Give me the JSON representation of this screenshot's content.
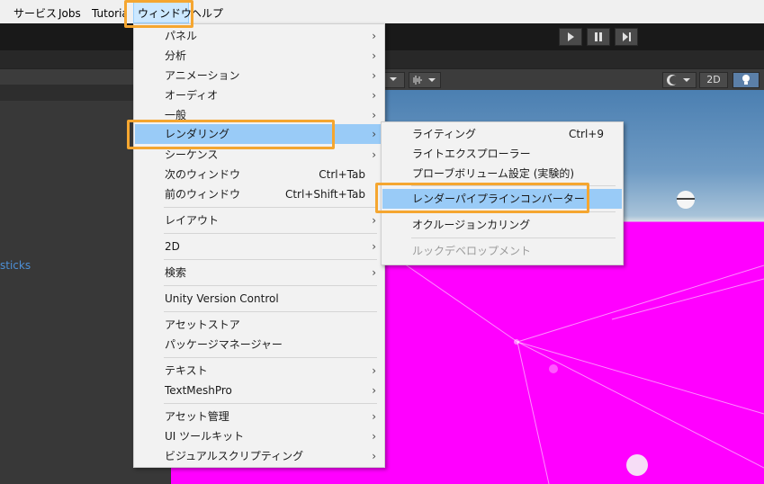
{
  "menubar": {
    "items": [
      "サービス",
      "Jobs",
      "Tutorials",
      "ウィンドウ",
      "ヘルプ"
    ]
  },
  "toolbar": {
    "play_icon": "play-icon",
    "pause_icon": "pause-icon",
    "step_icon": "step-icon"
  },
  "scene": {
    "mode_2d_label": "2D"
  },
  "hierarchy": {
    "partial_text": "sticks"
  },
  "window_menu": {
    "items": [
      {
        "label": "パネル",
        "shortcut": "",
        "submenu": true
      },
      {
        "label": "分析",
        "shortcut": "",
        "submenu": true
      },
      {
        "label": "アニメーション",
        "shortcut": "",
        "submenu": true
      },
      {
        "label": "オーディオ",
        "shortcut": "",
        "submenu": true
      },
      {
        "label": "一般",
        "shortcut": "",
        "submenu": true
      },
      {
        "label": "レンダリング",
        "shortcut": "",
        "submenu": true,
        "highlighted": true
      },
      {
        "label": "シーケンス",
        "shortcut": "",
        "submenu": true
      },
      {
        "label": "次のウィンドウ",
        "shortcut": "Ctrl+Tab",
        "submenu": false
      },
      {
        "label": "前のウィンドウ",
        "shortcut": "Ctrl+Shift+Tab",
        "submenu": false
      },
      {
        "label": "レイアウト",
        "shortcut": "",
        "submenu": true
      },
      {
        "label": "2D",
        "shortcut": "",
        "submenu": true
      },
      {
        "label": "検索",
        "shortcut": "",
        "submenu": true
      },
      {
        "label": "Unity Version Control",
        "shortcut": "",
        "submenu": false
      },
      {
        "label": "アセットストア",
        "shortcut": "",
        "submenu": false
      },
      {
        "label": "パッケージマネージャー",
        "shortcut": "",
        "submenu": false
      },
      {
        "label": "テキスト",
        "shortcut": "",
        "submenu": true
      },
      {
        "label": "TextMeshPro",
        "shortcut": "",
        "submenu": true
      },
      {
        "label": "アセット管理",
        "shortcut": "",
        "submenu": true
      },
      {
        "label": "UI ツールキット",
        "shortcut": "",
        "submenu": true
      },
      {
        "label": "ビジュアルスクリプティング",
        "shortcut": "",
        "submenu": true
      }
    ]
  },
  "rendering_submenu": {
    "items": [
      {
        "label": "ライティング",
        "shortcut": "Ctrl+9"
      },
      {
        "label": "ライトエクスプローラー",
        "shortcut": ""
      },
      {
        "label": "プローブボリューム設定 (実験的)",
        "shortcut": ""
      },
      {
        "label": "レンダーパイプラインコンバーター",
        "shortcut": "",
        "highlighted": true
      },
      {
        "label": "オクルージョンカリング",
        "shortcut": ""
      },
      {
        "label": "ルックデベロップメント",
        "shortcut": "",
        "disabled": true
      }
    ]
  },
  "colors": {
    "highlight": "#99cbf7",
    "callout": "#f5a630",
    "scene_ground": "#ff00ff"
  }
}
